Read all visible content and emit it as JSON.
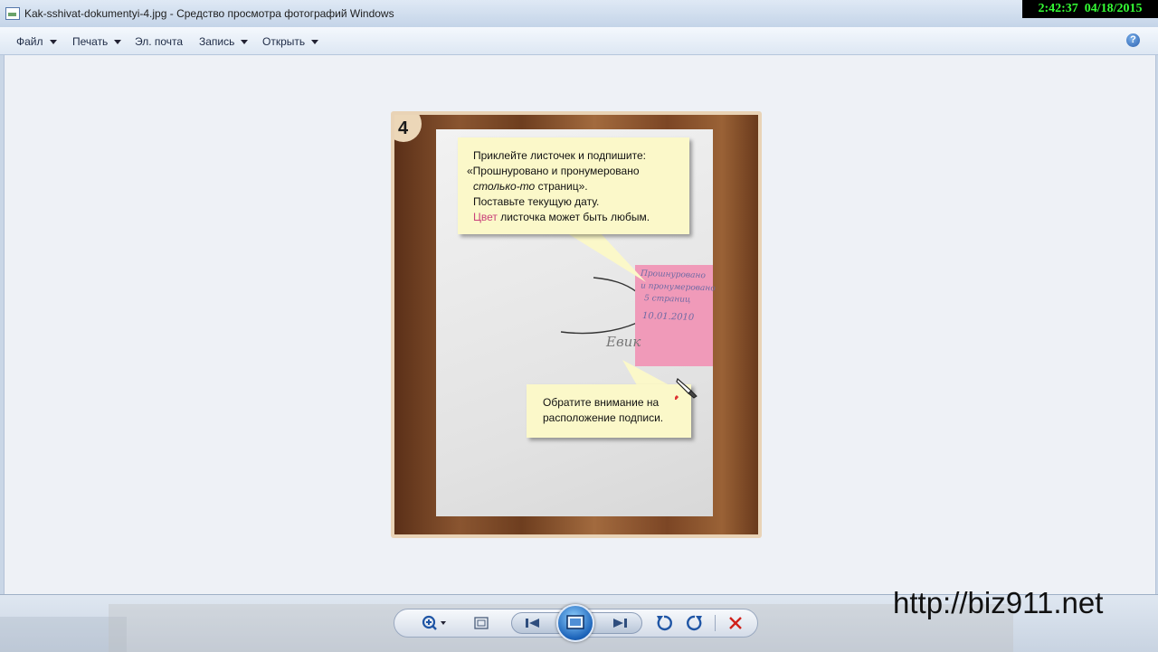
{
  "window": {
    "title": "Kak-sshivat-dokumentyi-4.jpg - Средство просмотра фотографий Windows"
  },
  "clock": {
    "time": "2:42:37",
    "date": "04/18/2015"
  },
  "menu": {
    "items": [
      {
        "label": "Файл",
        "has_dropdown": true
      },
      {
        "label": "Печать",
        "has_dropdown": true
      },
      {
        "label": "Эл. почта",
        "has_dropdown": false
      },
      {
        "label": "Запись",
        "has_dropdown": true
      },
      {
        "label": "Открыть",
        "has_dropdown": true
      }
    ],
    "help_icon": "?"
  },
  "photo": {
    "step_number": "4",
    "sticky_note_lines": [
      "Прошнуровано",
      "и пронумеровано",
      "5 страниц",
      "10.01.2010"
    ],
    "signature": "Евик",
    "callout_1": {
      "line1": "Приклейте листочек и подпишите:",
      "line2": "«Прошнуровано и пронумеровано",
      "line3_italic": "столько-то",
      "line3_rest": " страниц».",
      "line4": "Поставьте текущую дату.",
      "line5_accent": "Цвет",
      "line5_rest": " листочка может быть любым."
    },
    "callout_2": {
      "line1": "Обратите внимание на",
      "line2": "расположение подписи."
    }
  },
  "colors": {
    "accent_text": "#c9407a",
    "sticky_note": "#f09ab9",
    "callout_bg": "#fbf8c9",
    "clock_text": "#35ff35"
  },
  "controls": {
    "icons": [
      "zoom-icon",
      "actual-size-icon",
      "previous-icon",
      "slideshow-icon",
      "next-icon",
      "rotate-left-icon",
      "rotate-right-icon",
      "delete-icon"
    ]
  },
  "watermark": "http://biz911.net"
}
